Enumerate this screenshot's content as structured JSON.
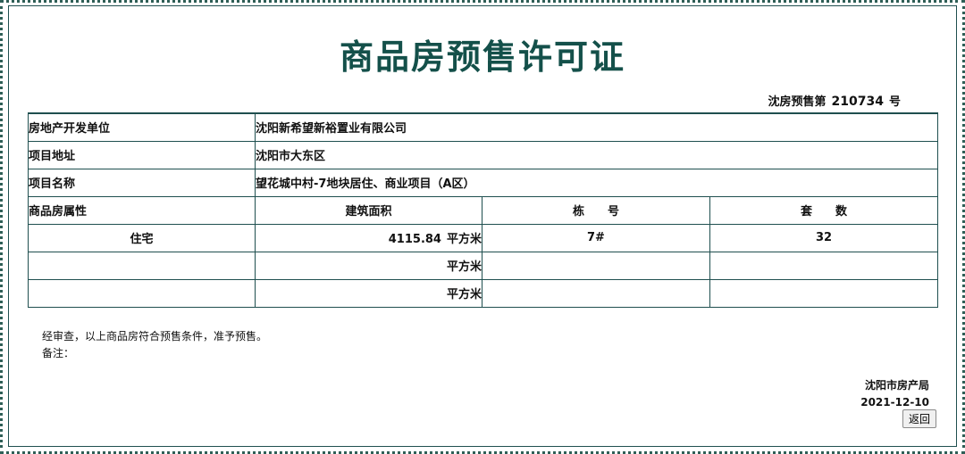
{
  "title": "商品房预售许可证",
  "permit": {
    "prefix": "沈房预售第",
    "number": "210734",
    "suffix": "号"
  },
  "info": [
    {
      "label": "房地产开发单位",
      "value": "沈阳新希望新裕置业有限公司"
    },
    {
      "label": "项目地址",
      "value": "沈阳市大东区"
    },
    {
      "label": "项目名称",
      "value": "望花城中村-7地块居住、商业项目（A区）"
    }
  ],
  "headers": {
    "property": "商品房属性",
    "area": "建筑面积",
    "building": "栋　　号",
    "units": "套　　数"
  },
  "rows": [
    {
      "property": "住宅",
      "area": "4115.84",
      "unit": "平方米",
      "building": "7#",
      "units": "32"
    },
    {
      "property": "",
      "area": "",
      "unit": "平方米",
      "building": "",
      "units": ""
    },
    {
      "property": "",
      "area": "",
      "unit": "平方米",
      "building": "",
      "units": ""
    }
  ],
  "notice": {
    "text": "经审查，以上商品房符合预售条件，准予预售。",
    "remark": "备注："
  },
  "footer": {
    "issuer": "沈阳市房产局",
    "date": "2021-12-10"
  },
  "back_label": "返回"
}
